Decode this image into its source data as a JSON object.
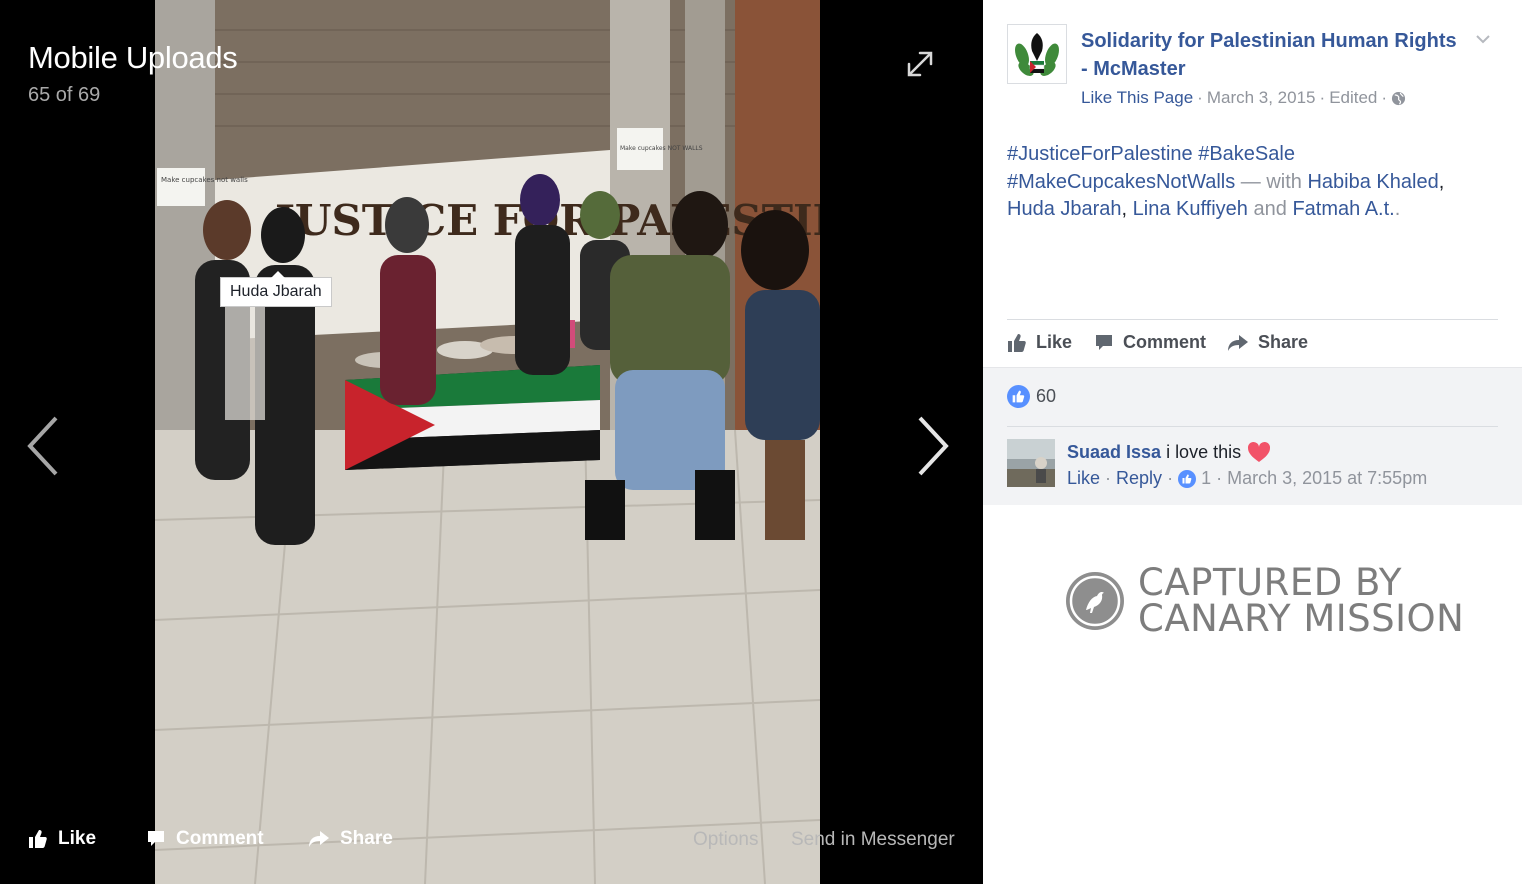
{
  "viewer": {
    "album_title": "Mobile Uploads",
    "photo_counter": "65 of 69",
    "tag_label": "Huda Jbarah",
    "actions": {
      "like": "Like",
      "comment": "Comment",
      "share": "Share",
      "options": "Options",
      "send_in_messenger": "Send in Messenger"
    },
    "icons": {
      "expand": "expand-icon",
      "prev": "chevron-left-icon",
      "next": "chevron-right-icon"
    },
    "photo_signs": {
      "banner": "JUSTICE FOR PALESTINE",
      "sign_left": "Make cupcakes not walls",
      "sign_right": "Make cupcakes NOT WALLS"
    }
  },
  "post": {
    "page_name": "Solidarity for Palestinian Human Rights - McMaster",
    "like_page_label": "Like This Page",
    "sep": "·",
    "date": "March 3, 2015",
    "edited": "Edited",
    "hashtags": [
      "#JusticeForPalestine",
      "#BakeSale",
      "#MakeCupcakesNotWalls"
    ],
    "with_text": "— with",
    "tagged": [
      "Habiba Khaled",
      "Huda Jbarah",
      "Lina Kuffiyeh",
      "Fatmah A.t."
    ],
    "comma": ",",
    "and_text": "and",
    "period": ".",
    "actions": {
      "like": "Like",
      "comment": "Comment",
      "share": "Share"
    },
    "reaction_count": "60"
  },
  "comment": {
    "author": "Suaad Issa",
    "text": "i love this",
    "like": "Like",
    "reply": "Reply",
    "like_count": "1",
    "timestamp": "March 3, 2015 at 7:55pm",
    "sep": "·"
  },
  "watermark": {
    "line1": "CAPTURED BY",
    "line2": "CANARY MISSION"
  },
  "colors": {
    "link": "#365899",
    "muted": "#90949c",
    "reaction_blue": "#5890ff",
    "heart": "#f25268"
  }
}
